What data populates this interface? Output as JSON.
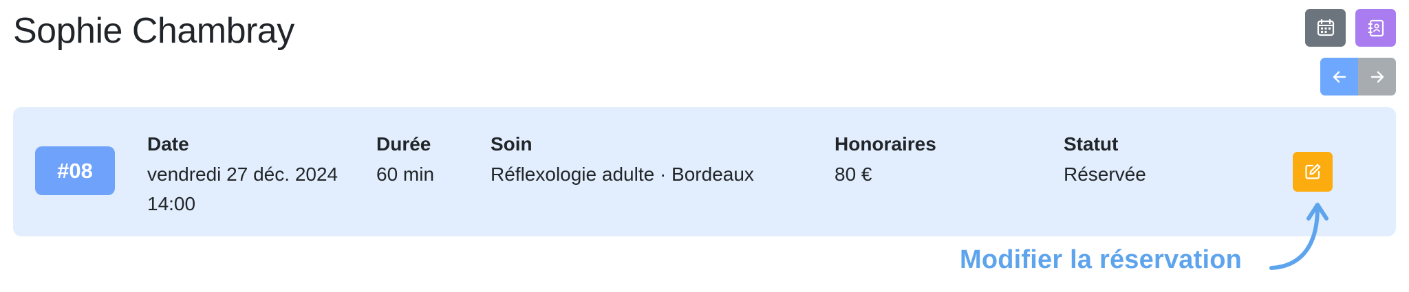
{
  "header": {
    "title": "Sophie Chambray"
  },
  "actions": {
    "calendar_icon": "calendar-icon",
    "contacts_icon": "address-book-icon",
    "prev_icon": "arrow-left-icon",
    "next_icon": "arrow-right-icon"
  },
  "booking": {
    "number": "#08",
    "columns": [
      {
        "label": "Date",
        "value": "vendredi 27 déc. 2024 14:00"
      },
      {
        "label": "Durée",
        "value": "60 min"
      },
      {
        "label": "Soin",
        "value": "Réflexologie adulte · Bordeaux"
      },
      {
        "label": "Honoraires",
        "value": "80 €"
      },
      {
        "label": "Statut",
        "value": "Réservée"
      }
    ],
    "edit_icon": "edit-icon"
  },
  "annotation": {
    "text": "Modifier la réservation"
  },
  "colors": {
    "card_background": "#e2eefd",
    "badge": "#6ea2fb",
    "edit_button": "#fcac0f",
    "calendar_button": "#6c757d",
    "contacts_button": "#a97cf0",
    "prev_button": "#6ea8fe",
    "next_button": "#a7acb1",
    "annotation": "#5ea4ed"
  }
}
